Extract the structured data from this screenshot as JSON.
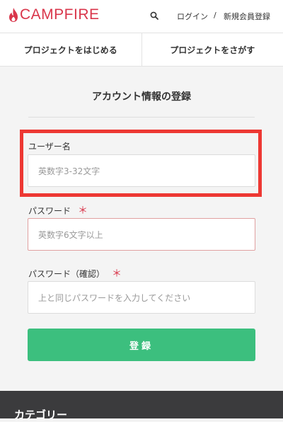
{
  "header": {
    "logo": "CAMPFIRE",
    "login": "ログイン",
    "separator": "/",
    "register": "新規会員登録"
  },
  "nav": {
    "start_project": "プロジェクトをはじめる",
    "find_project": "プロジェクトをさがす"
  },
  "form": {
    "title": "アカウント情報の登録",
    "username_label": "ユーザー名",
    "username_placeholder": "英数字3-32文字",
    "password_label": "パスワード",
    "password_placeholder": "英数字6文字以上",
    "password_confirm_label": "パスワード（確認）",
    "password_confirm_placeholder": "上と同じパスワードを入力してください",
    "required_mark": "＊",
    "submit_label": "登録"
  },
  "footer": {
    "category_title": "カテゴリー"
  },
  "colors": {
    "brand": "#d9364b",
    "submit": "#3cbf7e",
    "highlight": "#ed3833",
    "footer": "#3b3b3d"
  }
}
